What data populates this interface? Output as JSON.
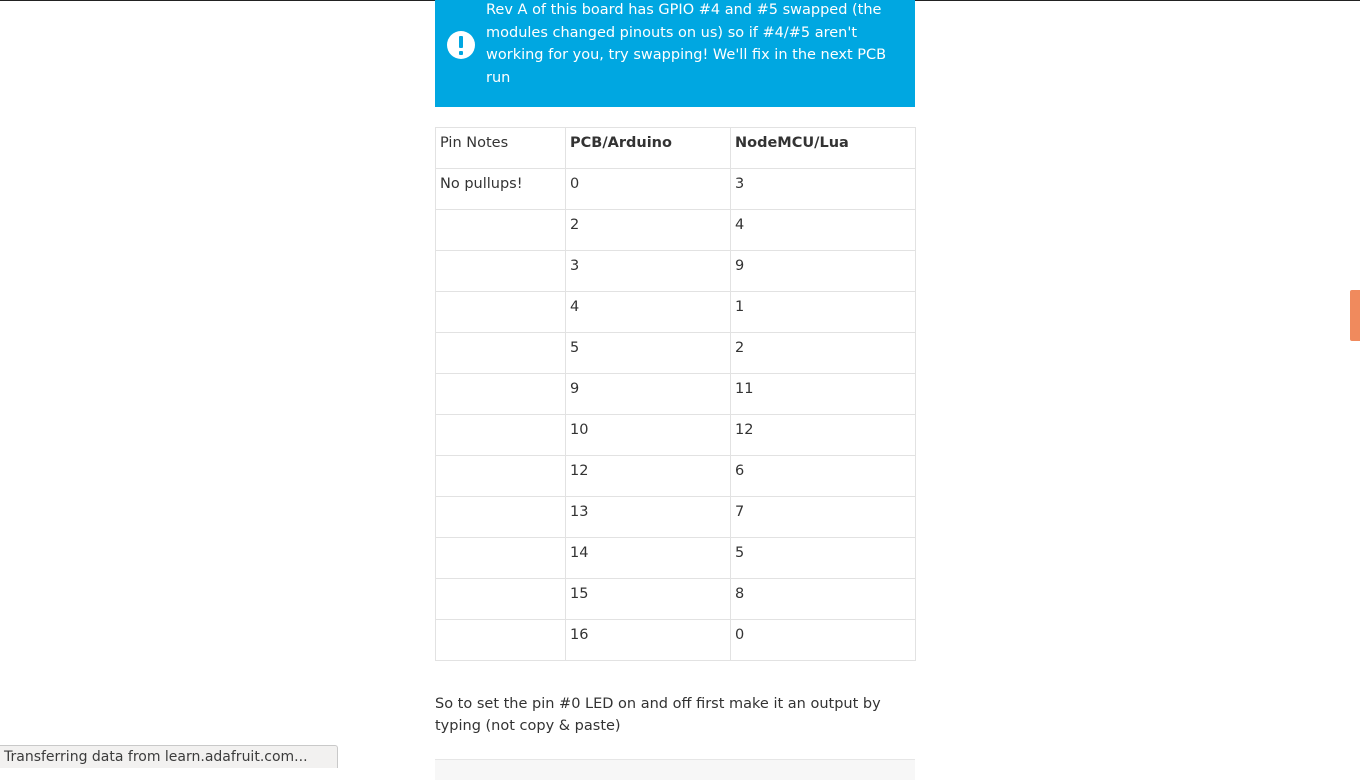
{
  "callout": {
    "icon": "exclamation-icon",
    "text": "Rev A of this board has GPIO #4 and #5 swapped (the modules changed pinouts on us) so if #4/#5 aren't working for you, try swapping! We'll fix in the next PCB run",
    "color": "#00a7e1"
  },
  "pin_table": {
    "headers": [
      "Pin Notes",
      "PCB/Arduino",
      "NodeMCU/Lua"
    ],
    "rows": [
      [
        "No pullups!",
        "0",
        "3"
      ],
      [
        "",
        "2",
        "4"
      ],
      [
        "",
        "3",
        "9"
      ],
      [
        "",
        "4",
        "1"
      ],
      [
        "",
        "5",
        "2"
      ],
      [
        "",
        "9",
        "11"
      ],
      [
        "",
        "10",
        "12"
      ],
      [
        "",
        "12",
        "6"
      ],
      [
        "",
        "13",
        "7"
      ],
      [
        "",
        "14",
        "5"
      ],
      [
        "",
        "15",
        "8"
      ],
      [
        "",
        "16",
        "0"
      ]
    ]
  },
  "paragraph": "So to set the pin #0 LED on and off first make it an output by typing (not copy & paste)",
  "status_bar": {
    "text": "Transferring data from learn.adafruit.com..."
  },
  "scrollbar": {
    "color": "#f08a5d"
  }
}
